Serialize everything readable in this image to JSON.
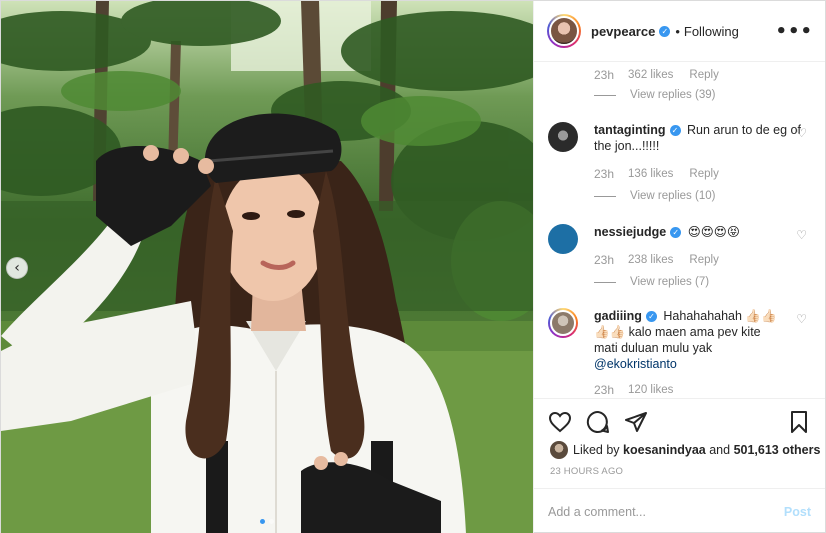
{
  "header": {
    "username": "pevpearce",
    "separator": "•",
    "follow_status": "Following",
    "more_glyph": "•••"
  },
  "comments": {
    "top_remnant": {
      "time": "23h",
      "likes": "362 likes",
      "reply": "Reply",
      "view_replies": "View replies (39)"
    },
    "items": [
      {
        "username": "tantaginting",
        "verified": true,
        "text": "Run arun to de eg of the jon...!!!!!",
        "time": "23h",
        "likes": "136 likes",
        "reply": "Reply",
        "view_replies": "View replies (10)",
        "avatar_color": "#2b2b2b"
      },
      {
        "username": "nessiejudge",
        "verified": true,
        "text": "😍😍😍😝",
        "time": "23h",
        "likes": "238 likes",
        "reply": "Reply",
        "view_replies": "View replies (7)",
        "avatar_color": "#1d6fa5"
      },
      {
        "username": "gadiiing",
        "verified": true,
        "text_line1": "Hahahahahah 👍🏻👍🏻",
        "text_line2": "👍🏻👍🏻 kalo maen ama pev kite",
        "text_line3": "mati duluan mulu yak",
        "mention": "@ekokristianto",
        "time": "23h",
        "likes": "120 likes",
        "avatar_color": "#d8d0c8"
      }
    ]
  },
  "actions": {
    "liked_by_user": "koesanindyaa",
    "liked_by_prefix": "Liked by",
    "liked_by_connector": "and",
    "others": "501,613 others",
    "timestamp": "23 HOURS AGO"
  },
  "add_comment": {
    "placeholder": "Add a comment...",
    "post_label": "Post"
  },
  "carousel": {
    "prev_glyph": "‹",
    "dot_count": 2,
    "active_dot": 1
  },
  "colors": {
    "accent_blue": "#3897f0",
    "muted_gray": "#999999",
    "post_disabled": "#b2dffc",
    "mention": "#003569"
  }
}
